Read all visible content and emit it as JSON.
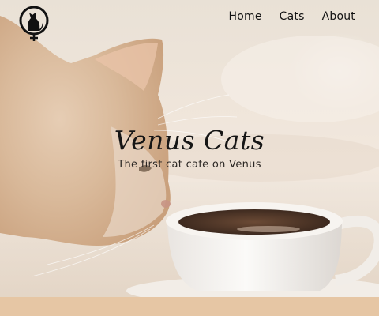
{
  "nav": {
    "links": [
      "Home",
      "Cats",
      "About"
    ]
  },
  "hero": {
    "title": "Venus Cats",
    "subtitle": "The first cat cafe on Venus"
  },
  "icons": {
    "logo": "cat-venus-symbol-icon"
  },
  "colors": {
    "accent_strip": "#e6c6a4",
    "text": "#111111",
    "hero_bg": "#efe5da"
  }
}
